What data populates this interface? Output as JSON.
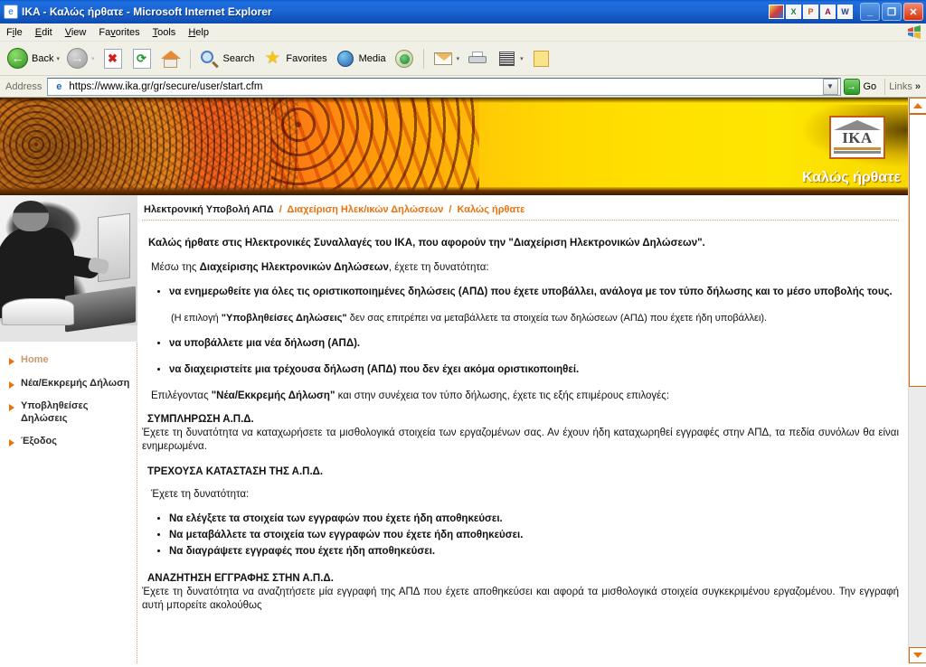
{
  "window": {
    "title": "IKA - Καλώς ήρθατε - Microsoft Internet Explorer",
    "app_icon": "ie-document-icon",
    "minimize_label": "_",
    "maximize_label": "❐",
    "close_label": "✕",
    "office_icons": [
      "office-shortcut-icon",
      "excel-icon",
      "powerpoint-icon",
      "access-icon",
      "word-icon"
    ]
  },
  "menu": {
    "items": [
      {
        "pre": "F",
        "key": "i",
        "post": "le",
        "full": "File"
      },
      {
        "pre": "",
        "key": "E",
        "post": "dit",
        "full": "Edit"
      },
      {
        "pre": "",
        "key": "V",
        "post": "iew",
        "full": "View"
      },
      {
        "pre": "Fa",
        "key": "v",
        "post": "orites",
        "full": "Favorites"
      },
      {
        "pre": "",
        "key": "T",
        "post": "ools",
        "full": "Tools"
      },
      {
        "pre": "",
        "key": "H",
        "post": "elp",
        "full": "Help"
      }
    ],
    "flag_icon": "windows-flag-icon"
  },
  "toolbar": {
    "back_label": "Back",
    "forward_label": "",
    "stop_label": "",
    "refresh_label": "",
    "home_label": "",
    "search_label": "Search",
    "favorites_label": "Favorites",
    "media_label": "Media",
    "history_label": "",
    "mail_label": "",
    "print_label": "",
    "edit_label": "",
    "discuss_label": "",
    "caret": "▾"
  },
  "address": {
    "label": "Address",
    "url": "https://www.ika.gr/gr/secure/user/start.cfm",
    "placeholder": "",
    "dropdown_icon": "chevron-down-icon",
    "go_label": "Go",
    "links_label": "Links",
    "chevrons": "»"
  },
  "banner": {
    "welcome": "Καλώς ήρθατε",
    "logo_text": "IKA",
    "photo_alt": "sunflower-banner-image"
  },
  "sidebar": {
    "photo_alt": "person-at-laptop-photo",
    "items": [
      {
        "label": "Home",
        "visited": true
      },
      {
        "label": "Νέα/Εκκρεμής Δήλωση",
        "visited": false
      },
      {
        "label": "Υποβληθείσες Δηλώσεις",
        "visited": false
      },
      {
        "label": "Έξοδος",
        "visited": false
      }
    ]
  },
  "breadcrumb": {
    "item0": "Ηλεκτρονική Υποβολή ΑΠΔ",
    "sep": "/",
    "item1": "Διαχείριση Ηλεκ/ικών Δηλώσεων",
    "item2": "Καλώς ήρθατε"
  },
  "content": {
    "intro_line1": "Καλώς ήρθατε στις Ηλεκτρονικές Συναλλαγές του ΙΚΑ, που αφορούν την \"Διαχείριση Ηλεκτρονικών Δηλώσεων\".",
    "lead_pre": "Μέσω της ",
    "lead_bold": "Διαχείρισης Ηλεκτρονικών Δηλώσεων",
    "lead_post": ", έχετε τη δυνατότητα:",
    "bullet1": "να ενημερωθείτε για όλες τις οριστικοποιημένες δηλώσεις (ΑΠΔ) που έχετε υποβάλλει, ανάλογα με τον τύπο δήλωσης και το μέσο υποβολής τους.",
    "note_pre": "(Η επιλογή ",
    "note_bold": "\"Υποβληθείσες Δηλώσεις\"",
    "note_post": " δεν σας επιτρέπει να μεταβάλλετε τα στοιχεία των δηλώσεων (ΑΠΔ) που έχετε ήδη υποβάλλει).",
    "bullet2": "να υποβάλλετε μια νέα δήλωση (ΑΠΔ).",
    "bullet3": "να διαχειριστείτε μια τρέχουσα δήλωση (ΑΠΔ) που δεν έχει ακόμα οριστικοποιηθεί.",
    "choose_pre": "Επιλέγοντας ",
    "choose_bold": "\"Νέα/Εκκρεμής Δήλωση\"",
    "choose_post": " και στην συνέχεια τον τύπο δήλωσης, έχετε τις εξής επιμέρους επιλογές:",
    "sec1_title": "ΣΥΜΠΛΗΡΩΣΗ Α.Π.Δ.",
    "sec1_text": "Έχετε τη δυνατότητα να καταχωρήσετε τα μισθολογικά στοιχεία των εργαζομένων σας. Αν έχουν ήδη καταχωρηθεί εγγραφές στην ΑΠΔ, τα πεδία συνόλων θα είναι ενημερωμένα.",
    "sec2_title": "ΤΡΕΧΟΥΣΑ ΚΑΤΑΣΤΑΣΗ ΤΗΣ Α.Π.Δ.",
    "sec2_lead": "Έχετε τη δυνατότητα:",
    "sec2_bullet1": "Να ελέγξετε τα στοιχεία των εγγραφών που έχετε ήδη αποθηκεύσει.",
    "sec2_bullet2": "Να μεταβάλλετε τα στοιχεία των εγγραφών που έχετε ήδη αποθηκεύσει.",
    "sec2_bullet3": "Να διαγράψετε εγγραφές που έχετε ήδη αποθηκεύσει.",
    "sec3_title": "ΑΝΑΖΗΤΗΣΗ ΕΓΓΡΑΦΗΣ ΣΤΗΝ Α.Π.Δ.",
    "sec3_text": "Έχετε τη δυνατότητα να αναζητήσετε μία εγγραφή της ΑΠΔ που έχετε αποθηκεύσει και αφορά τα μισθολογικά στοιχεία συγκεκριμένου εργαζομένου. Την εγγραφή αυτή μπορείτε ακολούθως"
  },
  "scrollbar": {
    "up_icon": "scroll-up-arrow-icon",
    "down_icon": "scroll-down-arrow-icon",
    "accent": "#e8720f"
  }
}
